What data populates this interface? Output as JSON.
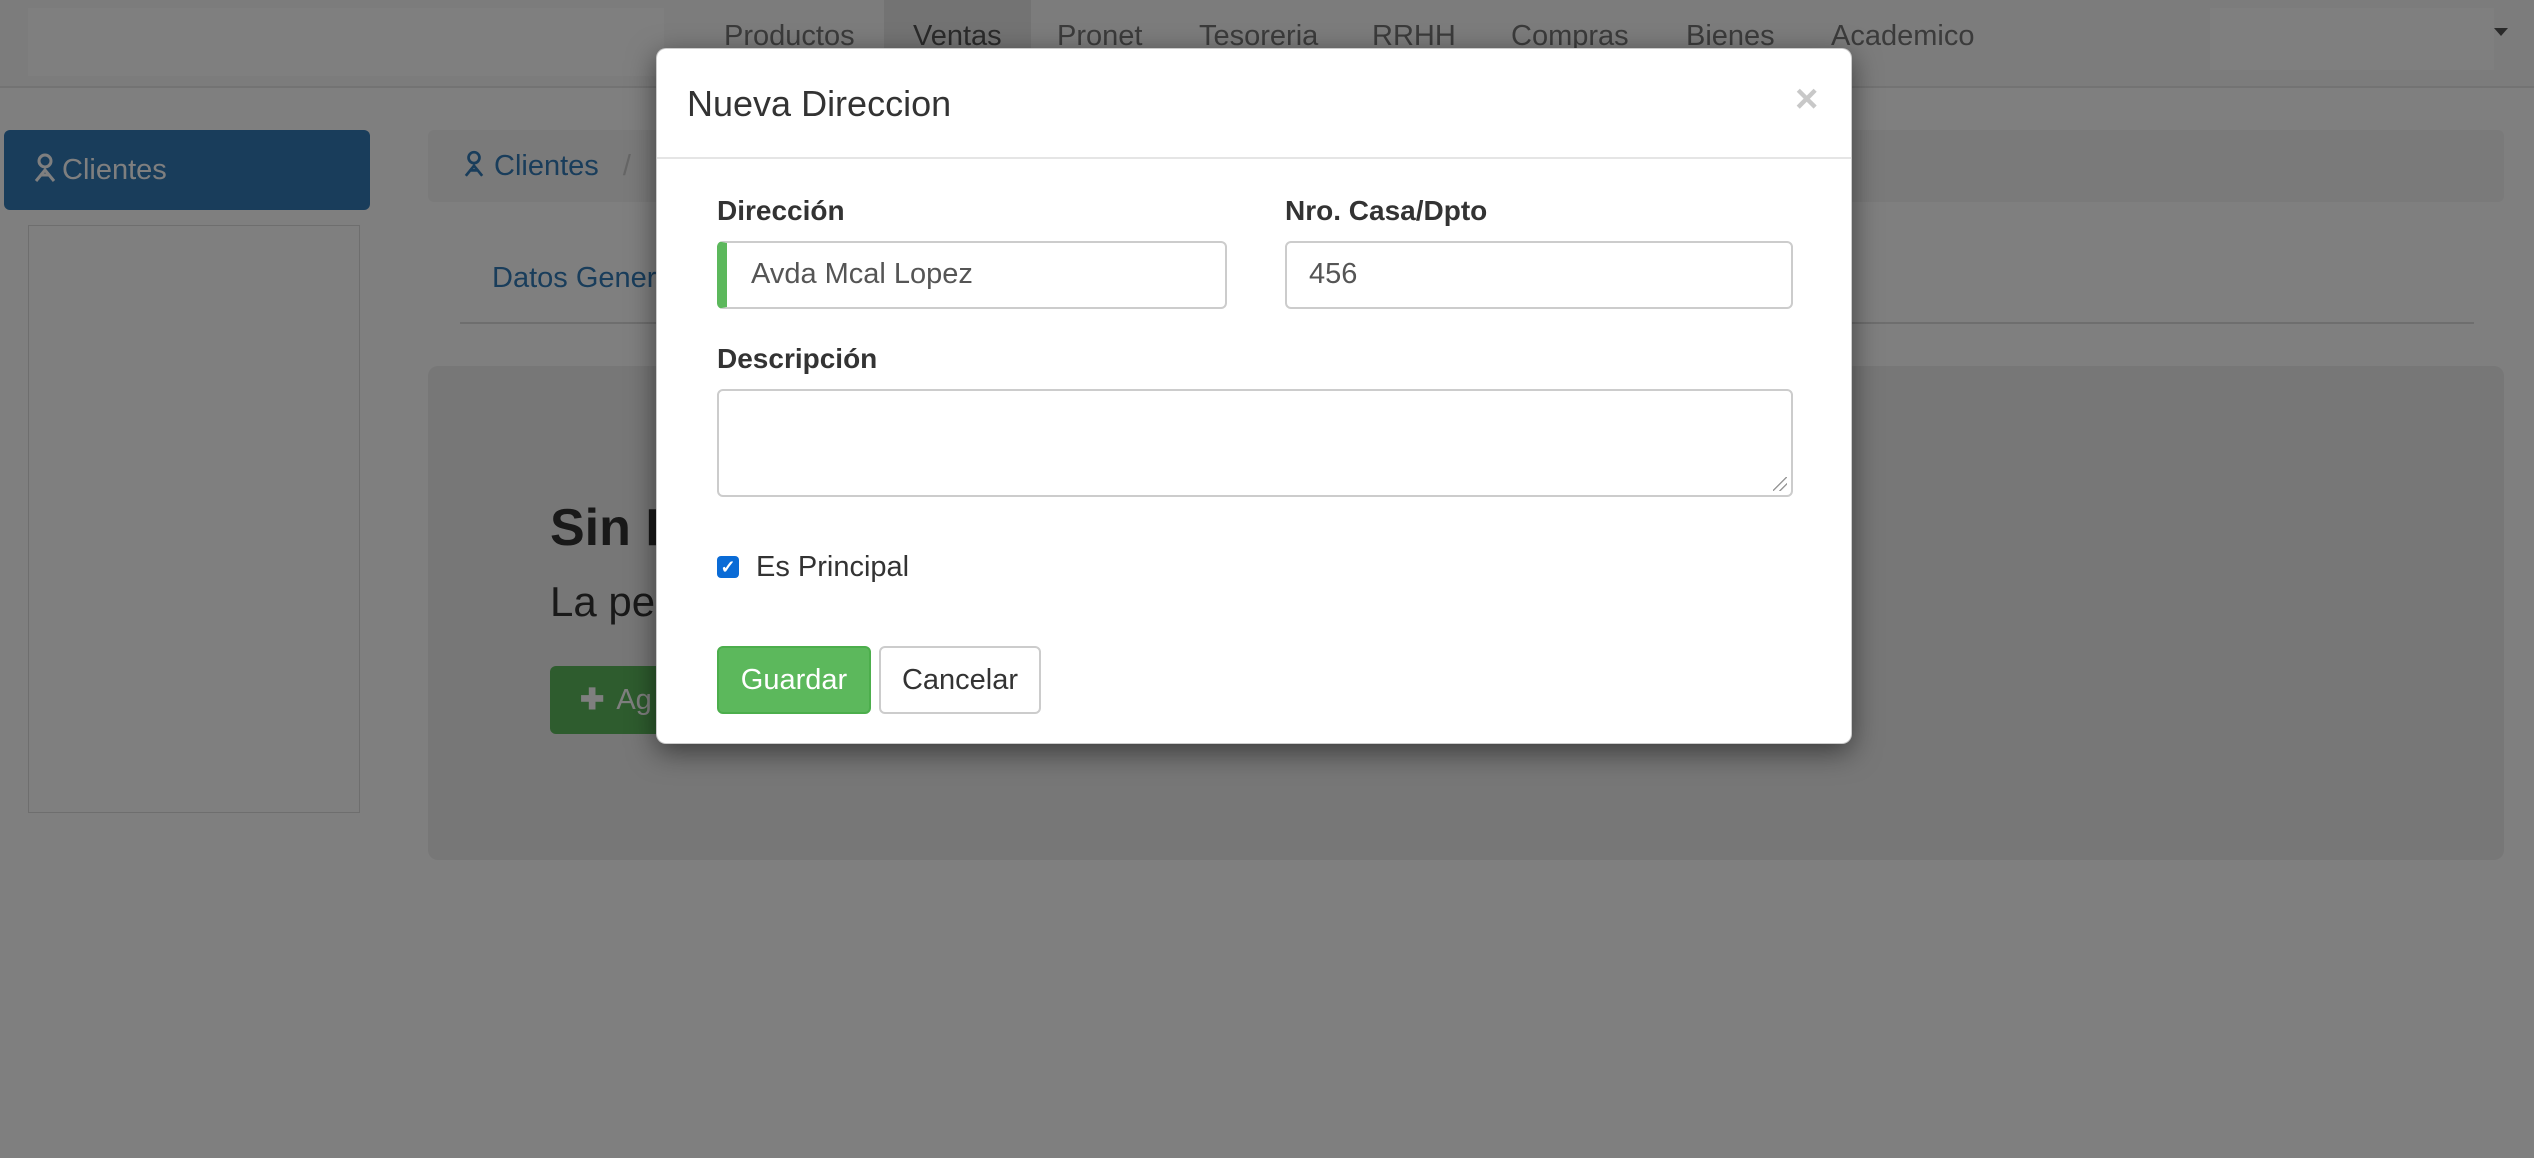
{
  "navbar": {
    "items": [
      "Productos",
      "Ventas",
      "Pronet",
      "Tesoreria",
      "RRHH",
      "Compras",
      "Bienes",
      "Academico"
    ],
    "active": "Ventas"
  },
  "sidebar": {
    "active_item": "Clientes",
    "active_icon": "user-icon"
  },
  "breadcrumb": {
    "root": "Clientes",
    "separator": "/"
  },
  "tabs": {
    "first": "Datos Genera"
  },
  "empty_state": {
    "title": "Sin F",
    "text": "La per",
    "add_button": "Ag"
  },
  "modal": {
    "title": "Nueva Direccion",
    "close": "×",
    "fields": {
      "direccion": {
        "label": "Dirección",
        "value": "Avda Mcal Lopez"
      },
      "nro": {
        "label": "Nro. Casa/Dpto",
        "value": "456"
      },
      "descripcion": {
        "label": "Descripción",
        "value": ""
      }
    },
    "checkbox": {
      "label": "Es Principal",
      "checked": true
    },
    "buttons": {
      "save": "Guardar",
      "cancel": "Cancelar"
    }
  },
  "colors": {
    "primary": "#337ab7",
    "success": "#5cb85c",
    "overlay": "rgba(0,0,0,0.5)"
  }
}
